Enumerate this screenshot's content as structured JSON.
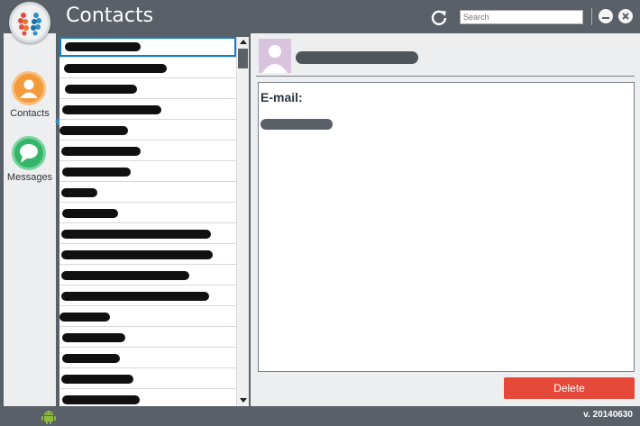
{
  "window": {
    "title": "Contacts",
    "search_placeholder": "Search"
  },
  "icons": {
    "logo": "brain-logo-icon",
    "refresh": "refresh-icon",
    "minimize": "minimize-icon",
    "close": "close-icon",
    "contacts": "person-icon",
    "messages": "chat-bubble-icon",
    "android": "android-icon"
  },
  "nav": {
    "items": [
      {
        "label": "Contacts",
        "icon": "person-icon",
        "color": "#f39a3b",
        "active": true
      },
      {
        "label": "Messages",
        "icon": "chat-bubble-icon",
        "color": "#35b56a",
        "active": false
      }
    ]
  },
  "contacts": {
    "selected_index": 0,
    "visible_rows": 18,
    "names_redacted": true
  },
  "detail": {
    "email_label": "E-mail:",
    "name_redacted": true,
    "email_redacted": true,
    "delete_label": "Delete"
  },
  "status": {
    "version": "v. 20140630"
  },
  "colors": {
    "chrome": "#5a6068",
    "panel": "#eceeef",
    "selection": "#0f7fcb",
    "delete": "#e5493a",
    "accent_arrow": "#2f8fc4",
    "avatar_bg": "#d9c3de"
  }
}
